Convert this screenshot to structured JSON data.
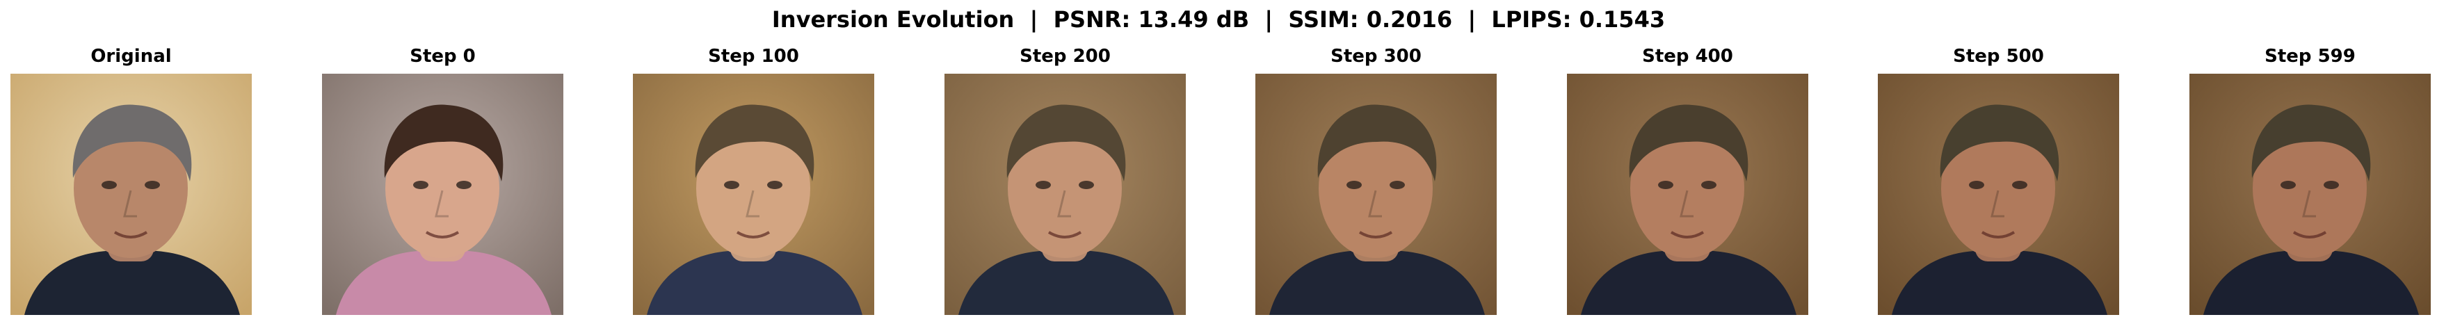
{
  "figure": {
    "suptitle": "Inversion Evolution  |  PSNR: 13.49 dB  |  SSIM: 0.2016  |  LPIPS: 0.1543"
  },
  "panels": [
    {
      "title": "Original",
      "image": "face-original-photo",
      "palette": {
        "bg": "#c8a56a",
        "bg2": "#e6d2a8",
        "skin": "#b8876a",
        "hair": "#6f6c6c",
        "cloth": "#1d2433"
      }
    },
    {
      "title": "Step 0",
      "image": "face-step-0-reconstruction",
      "palette": {
        "bg": "#7e6f68",
        "bg2": "#b7a9a4",
        "skin": "#d8a68c",
        "hair": "#3f2a20",
        "cloth": "#c88aa8"
      }
    },
    {
      "title": "Step 100",
      "image": "face-step-100-reconstruction",
      "palette": {
        "bg": "#8a6a40",
        "bg2": "#c09a62",
        "skin": "#d3a582",
        "hair": "#5a4a35",
        "cloth": "#2c3550"
      }
    },
    {
      "title": "Step 200",
      "image": "face-step-200-reconstruction",
      "palette": {
        "bg": "#7b6040",
        "bg2": "#a58660",
        "skin": "#c59475",
        "hair": "#544734",
        "cloth": "#222a3c"
      }
    },
    {
      "title": "Step 300",
      "image": "face-step-300-reconstruction",
      "palette": {
        "bg": "#735535",
        "bg2": "#9c7c56",
        "skin": "#b98565",
        "hair": "#4e4230",
        "cloth": "#1f2535"
      }
    },
    {
      "title": "Step 400",
      "image": "face-step-400-reconstruction",
      "palette": {
        "bg": "#6e5030",
        "bg2": "#987752",
        "skin": "#b47e60",
        "hair": "#4a3f2e",
        "cloth": "#1d2232"
      }
    },
    {
      "title": "Step 500",
      "image": "face-step-500-reconstruction",
      "palette": {
        "bg": "#6c4e2e",
        "bg2": "#95744f",
        "skin": "#b07a5c",
        "hair": "#48402f",
        "cloth": "#1c2131"
      }
    },
    {
      "title": "Step 599",
      "image": "face-step-599-reconstruction",
      "palette": {
        "bg": "#6a4d2d",
        "bg2": "#93724e",
        "skin": "#ad775a",
        "hair": "#473f2f",
        "cloth": "#1b2030"
      }
    }
  ]
}
